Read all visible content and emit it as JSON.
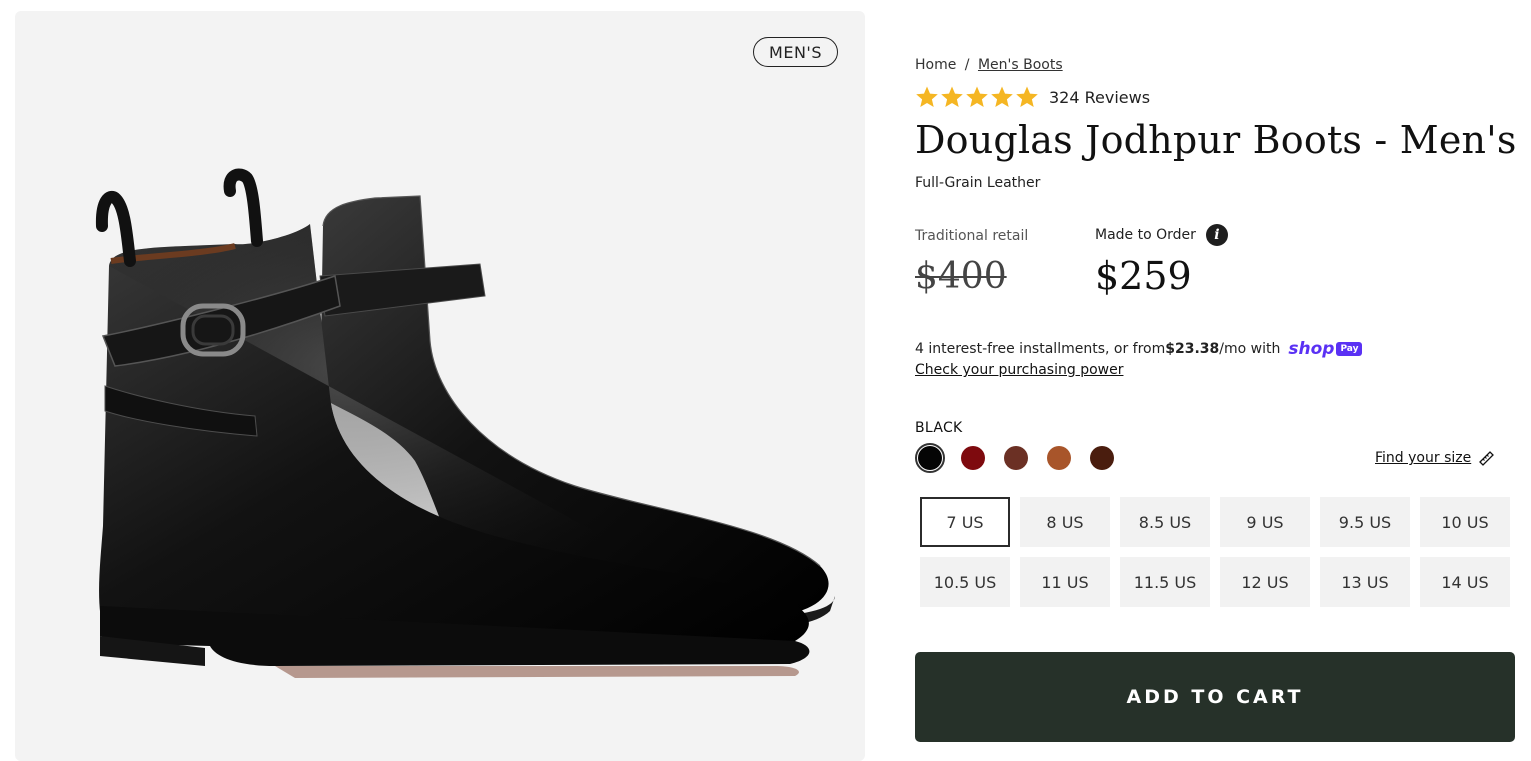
{
  "gallery": {
    "tag": "MEN'S"
  },
  "breadcrumb": {
    "home": "Home",
    "separator": "/",
    "category": "Men's Boots"
  },
  "rating": {
    "stars": 5,
    "reviews": "324 Reviews",
    "star_color": "#f5b623"
  },
  "product": {
    "title": "Douglas Jodhpur Boots - Men's",
    "material": "Full-Grain Leather"
  },
  "pricing": {
    "retail_label": "Traditional retail",
    "retail_price": "$400",
    "made_label": "Made to Order",
    "price": "$259"
  },
  "installments": {
    "text_before": "4 interest-free installments, or from ",
    "amount": "$23.38",
    "text_after": "/mo with",
    "brand": "shop",
    "brand_badge": "Pay",
    "brand_color": "#5a31f4",
    "link": "Check your purchasing power"
  },
  "color": {
    "selected_name": "BLACK",
    "swatches": [
      "#050505",
      "#7e0a0e",
      "#6b3024",
      "#a8552a",
      "#4a1d0e"
    ],
    "selected_index": 0
  },
  "size_guide": {
    "label": "Find your size",
    "icon": "ruler-icon"
  },
  "sizes": {
    "options": [
      "7 US",
      "8 US",
      "8.5 US",
      "9 US",
      "9.5 US",
      "10 US",
      "10.5 US",
      "11 US",
      "11.5 US",
      "12 US",
      "13 US",
      "14 US"
    ],
    "selected_index": 0
  },
  "cart": {
    "label": "ADD TO CART",
    "color": "#263129"
  }
}
